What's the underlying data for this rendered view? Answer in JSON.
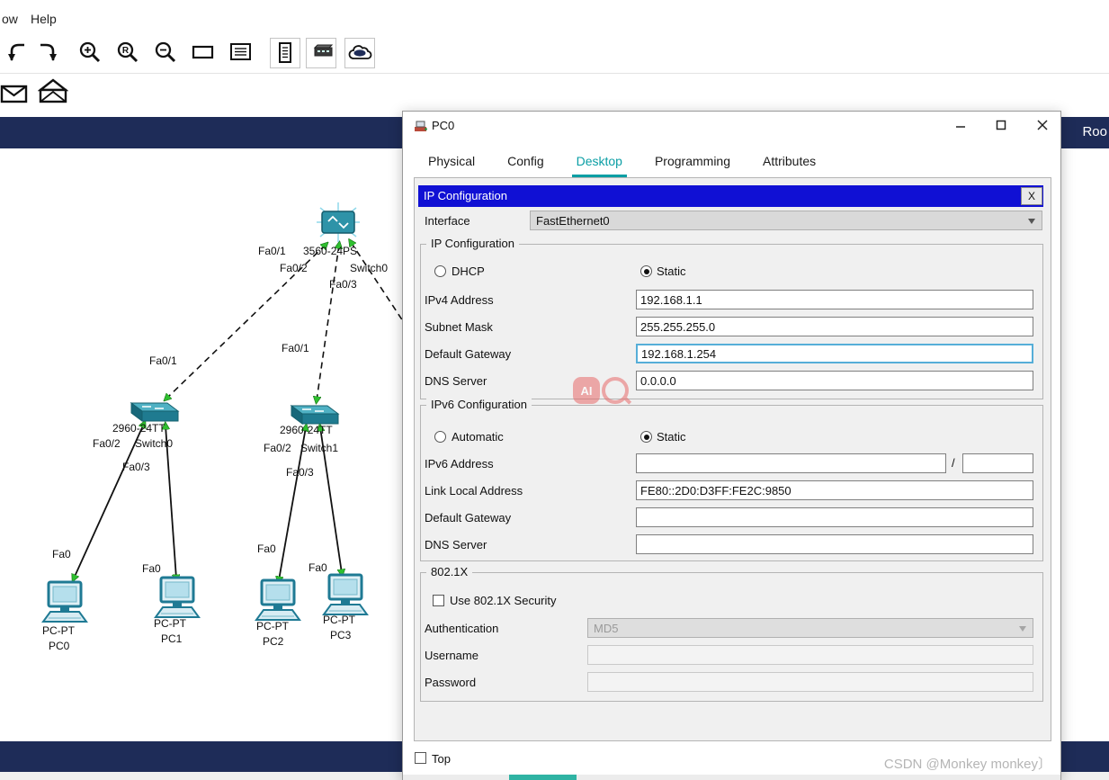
{
  "menu": {
    "window_fragment": "ow",
    "help": "Help"
  },
  "toolbar": {
    "zoom_reset_letter": "R"
  },
  "workspace": {
    "right_label": "Roo"
  },
  "topology": {
    "labels": [
      {
        "text": "Fa0/1"
      },
      {
        "text": "3560-24PS"
      },
      {
        "text": "Fa0/2"
      },
      {
        "text": "Switch0"
      },
      {
        "text": "Fa0/3"
      },
      {
        "text": "Fa0/1"
      },
      {
        "text": "Fa0/1"
      },
      {
        "text": "2960-24TT"
      },
      {
        "text": "Fa0/2"
      },
      {
        "text": "Switch0"
      },
      {
        "text": "Fa0/3"
      },
      {
        "text": "2960-24TT"
      },
      {
        "text": "Fa0/2"
      },
      {
        "text": "Switch1"
      },
      {
        "text": "Fa0/3"
      },
      {
        "text": "Fa0"
      },
      {
        "text": "Fa0"
      },
      {
        "text": "Fa0"
      },
      {
        "text": "Fa0"
      },
      {
        "text": "PC-PT"
      },
      {
        "text": "PC0"
      },
      {
        "text": "PC-PT"
      },
      {
        "text": "PC1"
      },
      {
        "text": "PC-PT"
      },
      {
        "text": "PC2"
      },
      {
        "text": "PC-PT"
      },
      {
        "text": "PC3"
      }
    ]
  },
  "dialog": {
    "window_title": "PC0",
    "tabs": [
      {
        "label": "Physical"
      },
      {
        "label": "Config"
      },
      {
        "label": "Desktop"
      },
      {
        "label": "Programming"
      },
      {
        "label": "Attributes"
      }
    ],
    "active_tab": "Desktop",
    "panel": {
      "header": "IP Configuration",
      "close": "X",
      "interface_label": "Interface",
      "interface_value": "FastEthernet0"
    },
    "ip": {
      "legend": "IP Configuration",
      "dhcp": "DHCP",
      "static": "Static",
      "mode": "Static",
      "ipv4_label": "IPv4 Address",
      "ipv4_value": "192.168.1.1",
      "mask_label": "Subnet Mask",
      "mask_value": "255.255.255.0",
      "gw_label": "Default Gateway",
      "gw_value": "192.168.1.254",
      "dns_label": "DNS Server",
      "dns_value": "0.0.0.0"
    },
    "ipv6": {
      "legend": "IPv6 Configuration",
      "auto": "Automatic",
      "static": "Static",
      "mode": "Static",
      "addr_label": "IPv6 Address",
      "addr_value": "",
      "separator": "/",
      "prefix_value": "",
      "lla_label": "Link Local Address",
      "lla_value": "FE80::2D0:D3FF:FE2C:9850",
      "gw_label": "Default Gateway",
      "gw_value": "",
      "dns_label": "DNS Server",
      "dns_value": ""
    },
    "dot1x": {
      "legend": "802.1X",
      "checkbox": "Use 802.1X Security",
      "enabled": false,
      "auth_label": "Authentication",
      "auth_value": "MD5",
      "user_label": "Username",
      "user_value": "",
      "pass_label": "Password",
      "pass_value": ""
    },
    "footer": {
      "top": "Top"
    }
  },
  "watermark": {
    "ai": "AI",
    "credit": "CSDN @Monkey monkey〕"
  }
}
